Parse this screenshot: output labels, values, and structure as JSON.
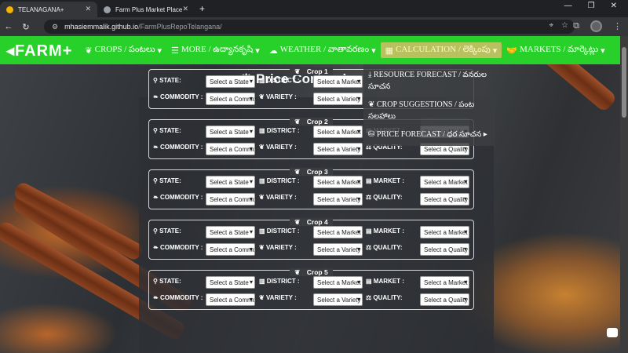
{
  "browser": {
    "tabs": [
      {
        "title": "TELANAGANA+",
        "favicon_color": "#f4b400"
      },
      {
        "title": "Farm Plus Market Place",
        "favicon_color": "#9aa0a6"
      }
    ],
    "address": {
      "host": "mhasiemmalik.github.io",
      "path": "/FarmPlusRepoTelangana/"
    }
  },
  "nav": {
    "logo": "FARM+",
    "items": [
      {
        "label": "CROPS / పంటలు",
        "icon": "seedling-icon"
      },
      {
        "label": "MORE / ఉద్యానకృషి",
        "icon": "list-icon"
      },
      {
        "label": "WEATHER / వాతావరణం",
        "icon": "cloud-icon"
      },
      {
        "label": "CALCULATION / లెక్కింపు",
        "icon": "calculator-icon"
      },
      {
        "label": "MARKETS / మార్కెట్లు",
        "icon": "handshake-icon"
      }
    ],
    "dropdown": [
      {
        "label": "RESOURCE FORECAST / వనరుల సూచన"
      },
      {
        "label": "CROP SUGGESTIONS / పంట సలహాలు"
      },
      {
        "label": "PRICE FORECAST / ధర సూచన"
      }
    ]
  },
  "page": {
    "title": "Price Compariso"
  },
  "labels": {
    "state": "STATE:",
    "district": "DISTRICT :",
    "market": "MARKET :",
    "commodity": "COMMODITY :",
    "variety": "VARIETY :",
    "quality": "QUALITY:"
  },
  "placeholders": {
    "state": "Select a State",
    "district": "Select a Market",
    "market": "Select a Market",
    "commodity": "Select a Commodity",
    "variety": "Select a Variety",
    "quality": "Select a Quality"
  },
  "crops": [
    {
      "title": "Crop 1"
    },
    {
      "title": "Crop 2"
    },
    {
      "title": "Crop 3"
    },
    {
      "title": "Crop 4"
    },
    {
      "title": "Crop 5"
    }
  ]
}
